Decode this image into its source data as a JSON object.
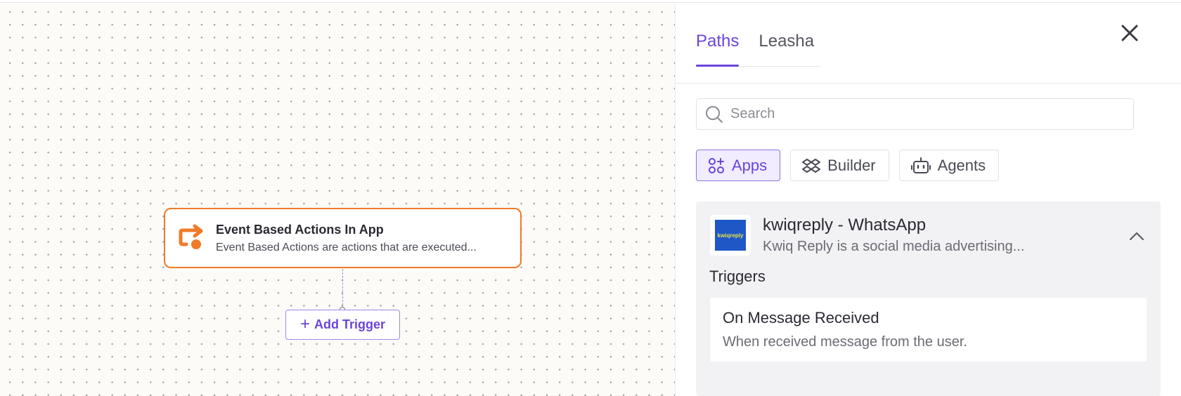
{
  "canvas": {
    "node": {
      "title": "Event Based Actions In App",
      "description": "Event Based Actions are actions that are executed..."
    },
    "add_trigger_label": "Add Trigger"
  },
  "panel": {
    "tabs": [
      {
        "label": "Paths",
        "active": true
      },
      {
        "label": "Leasha",
        "active": false
      }
    ],
    "search": {
      "placeholder": "Search",
      "value": ""
    },
    "filters": [
      {
        "label": "Apps",
        "icon": "apps-icon",
        "active": true
      },
      {
        "label": "Builder",
        "icon": "builder-icon",
        "active": false
      },
      {
        "label": "Agents",
        "icon": "robot-icon",
        "active": false
      }
    ],
    "app": {
      "logo_text": "kwiqreply",
      "name": "kwiqreply - WhatsApp",
      "description": "Kwiq Reply is a social media advertising...",
      "triggers_heading": "Triggers",
      "triggers": [
        {
          "name": "On Message Received",
          "description": "When received message from the user."
        }
      ]
    }
  },
  "colors": {
    "accent": "#6a45d9",
    "node_border": "#f07a2a",
    "canvas_bg": "#fcfbf7",
    "app_logo_bg": "#1f57c6"
  }
}
